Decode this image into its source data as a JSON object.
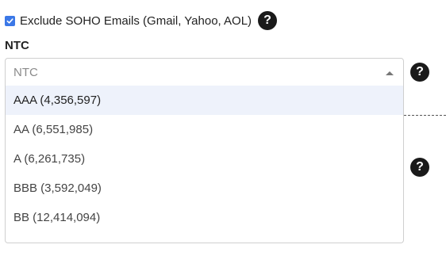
{
  "soho": {
    "checked": true,
    "label": "Exclude SOHO Emails (Gmail, Yahoo, AOL)",
    "help_glyph": "?"
  },
  "ntc": {
    "label": "NTC",
    "placeholder": "NTC",
    "help_glyph": "?",
    "options": [
      {
        "label": "AAA (4,356,597)"
      },
      {
        "label": "AA (6,551,985)"
      },
      {
        "label": "A (6,261,735)"
      },
      {
        "label": "BBB (3,592,049)"
      },
      {
        "label": "BB (12,414,094)"
      }
    ]
  },
  "lower_help_glyph": "?",
  "colors": {
    "accent": "#3b78e7",
    "highlight": "#eef2fb",
    "border": "#cfcfcf",
    "help_bg": "#1a1a1a"
  },
  "icons": {
    "checkbox": "check-icon",
    "help": "question-circle-icon",
    "caret": "caret-up-icon"
  }
}
